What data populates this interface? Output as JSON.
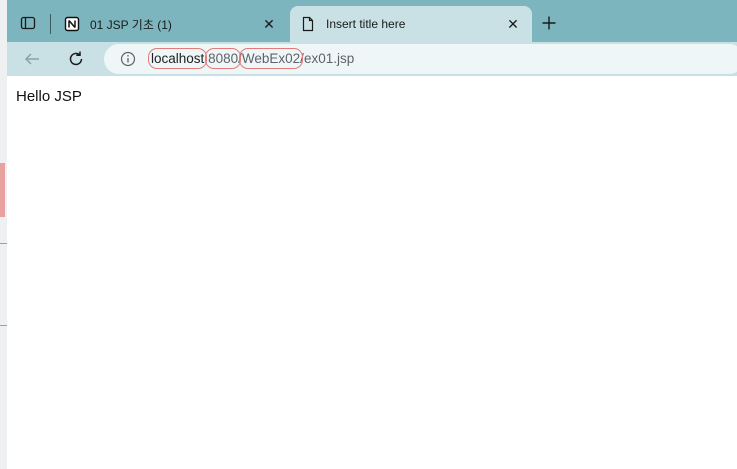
{
  "tabs": [
    {
      "title": "01 JSP 기초 (1)",
      "favicon": "notion-icon",
      "active": false
    },
    {
      "title": "Insert title here",
      "favicon": "document-icon",
      "active": true
    }
  ],
  "address": {
    "host": "localhost",
    "port_sep": ":",
    "port": "8080",
    "slash1": "/",
    "context": "WebEx02",
    "slash2": "/",
    "file": "ex01.jsp"
  },
  "page": {
    "body_text": "Hello JSP"
  },
  "colors": {
    "tabbar": "#7cb5be",
    "active_tab": "#c9e1e5",
    "annotation": "#e37b7b"
  }
}
